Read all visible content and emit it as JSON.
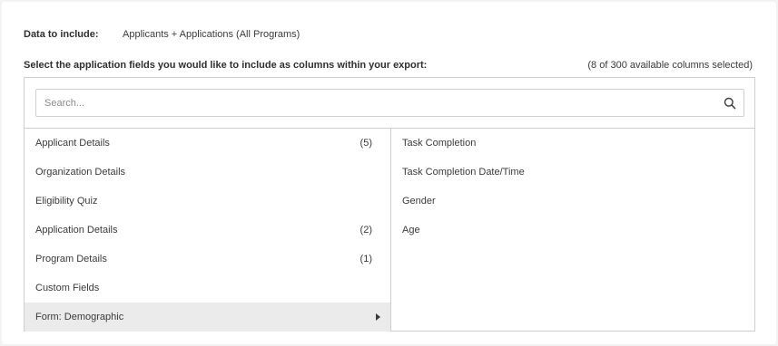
{
  "data_include": {
    "label": "Data to include:",
    "value": "Applicants + Applications (All Programs)"
  },
  "fields_prompt": "Select the application fields you would like to include as columns within your export:",
  "selection_count": "(8 of 300 available columns selected)",
  "search": {
    "placeholder": "Search...",
    "value": "",
    "icon": "search-icon"
  },
  "categories": [
    {
      "label": "Applicant Details",
      "count": "(5)"
    },
    {
      "label": "Organization Details",
      "count": ""
    },
    {
      "label": "Eligibility Quiz",
      "count": ""
    },
    {
      "label": "Application Details",
      "count": "(2)"
    },
    {
      "label": "Program Details",
      "count": "(1)"
    },
    {
      "label": "Custom Fields",
      "count": ""
    },
    {
      "label": "Form: Demographic",
      "count": "",
      "selected": true
    }
  ],
  "fields": [
    {
      "label": "Task Completion"
    },
    {
      "label": "Task Completion Date/Time"
    },
    {
      "label": "Gender"
    },
    {
      "label": "Age"
    }
  ],
  "colors": {
    "selected_row_bg": "#ebebeb",
    "border": "#cfcfcf",
    "text": "#3b3b3b"
  }
}
